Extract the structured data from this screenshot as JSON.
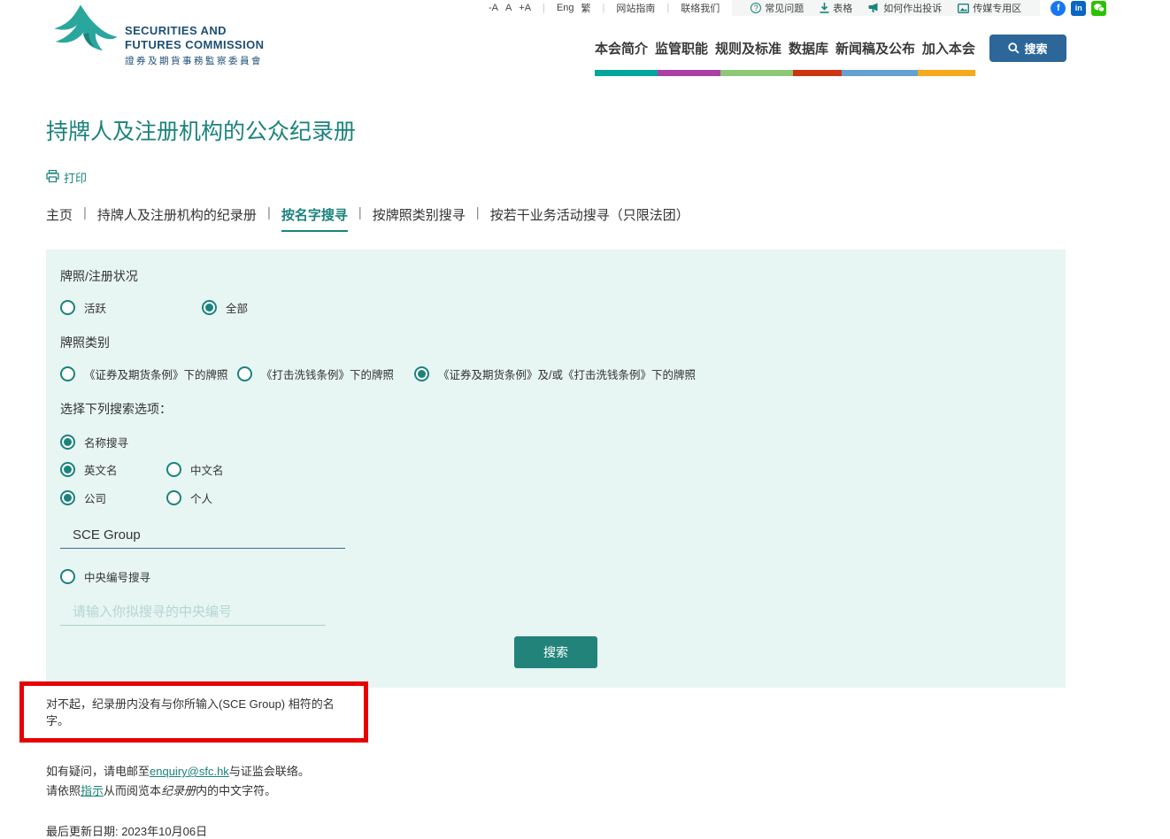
{
  "utility_bar": {
    "font_small": "-A",
    "font_normal": "A",
    "font_large": "+A",
    "lang_eng": "Eng",
    "lang_trad": "繁",
    "site_guide": "网站指南",
    "contact_us": "联络我们",
    "quick_links": [
      {
        "icon": "question-circle-icon",
        "label": "常见问题"
      },
      {
        "icon": "download-icon",
        "label": "表格"
      },
      {
        "icon": "megaphone-icon",
        "label": "如何作出投诉"
      },
      {
        "icon": "media-icon",
        "label": "传媒专用区"
      }
    ]
  },
  "logo": {
    "line1": "SECURITIES AND",
    "line2": "FUTURES COMMISSION",
    "line3": "證券及期貨事務監察委員會"
  },
  "main_nav": {
    "items": [
      "本会简介",
      "监管职能",
      "规则及标准",
      "数据库",
      "新闻稿及公布",
      "加入本会"
    ],
    "search_label": "搜索",
    "bar_colors": [
      "#00a59c",
      "#ac3fa5",
      "#8dc877",
      "#cf3410",
      "#63a0d4",
      "#f7a81b"
    ]
  },
  "page": {
    "title": "持牌人及注册机构的公众纪录册",
    "print_label": "打印"
  },
  "tabs": {
    "items": [
      {
        "label": "主页",
        "active": false
      },
      {
        "label": "持牌人及注册机构的纪录册",
        "active": false
      },
      {
        "label": "按名字搜寻",
        "active": true
      },
      {
        "label": "按牌照类别搜寻",
        "active": false
      },
      {
        "label": "按若干业务活动搜寻（只限法团）",
        "active": false
      }
    ]
  },
  "form": {
    "status_label": "牌照/注册状况",
    "status_options": [
      {
        "label": "活跃",
        "checked": false
      },
      {
        "label": "全部",
        "checked": true
      }
    ],
    "type_label": "牌照类别",
    "type_options": [
      {
        "label": "《证券及期货条例》下的牌照",
        "checked": false
      },
      {
        "label": "《打击洗钱条例》下的牌照",
        "checked": false
      },
      {
        "label": "《证券及期货条例》及/或《打击洗钱条例》下的牌照",
        "checked": true
      }
    ],
    "search_options_label": "选择下列搜索选项：",
    "name_search_label": "名称搜寻",
    "name_search_checked": true,
    "lang_options": [
      {
        "label": "英文名",
        "checked": true
      },
      {
        "label": "中文名",
        "checked": false
      }
    ],
    "entity_options": [
      {
        "label": "公司",
        "checked": true
      },
      {
        "label": "个人",
        "checked": false
      }
    ],
    "name_input_value": "SCE Group",
    "ce_search_label": "中央编号搜寻",
    "ce_search_checked": false,
    "ce_input_placeholder": "请输入你拟搜寻的中央编号",
    "submit_label": "搜索"
  },
  "error": {
    "message": "对不起，纪录册内没有与你所输入(SCE Group) 相符的名字。"
  },
  "footer": {
    "contact_prefix": "如有疑问，请电邮至",
    "contact_email": "enquiry@sfc.hk",
    "contact_suffix": "与证监会联络。",
    "instruction_prefix": "请依照",
    "instruction_link": "指示",
    "instruction_mid": "从而阅览本",
    "instruction_italic": "纪录册",
    "instruction_suffix": "内的中文字符。",
    "last_updated": "最后更新日期: 2023年10月06日"
  },
  "colors": {
    "accent_teal": "#1b837c",
    "panel_bg": "#e7f5f3",
    "submit_teal": "#21837a",
    "header_search_blue": "#2d6698",
    "error_red": "#e60000"
  }
}
